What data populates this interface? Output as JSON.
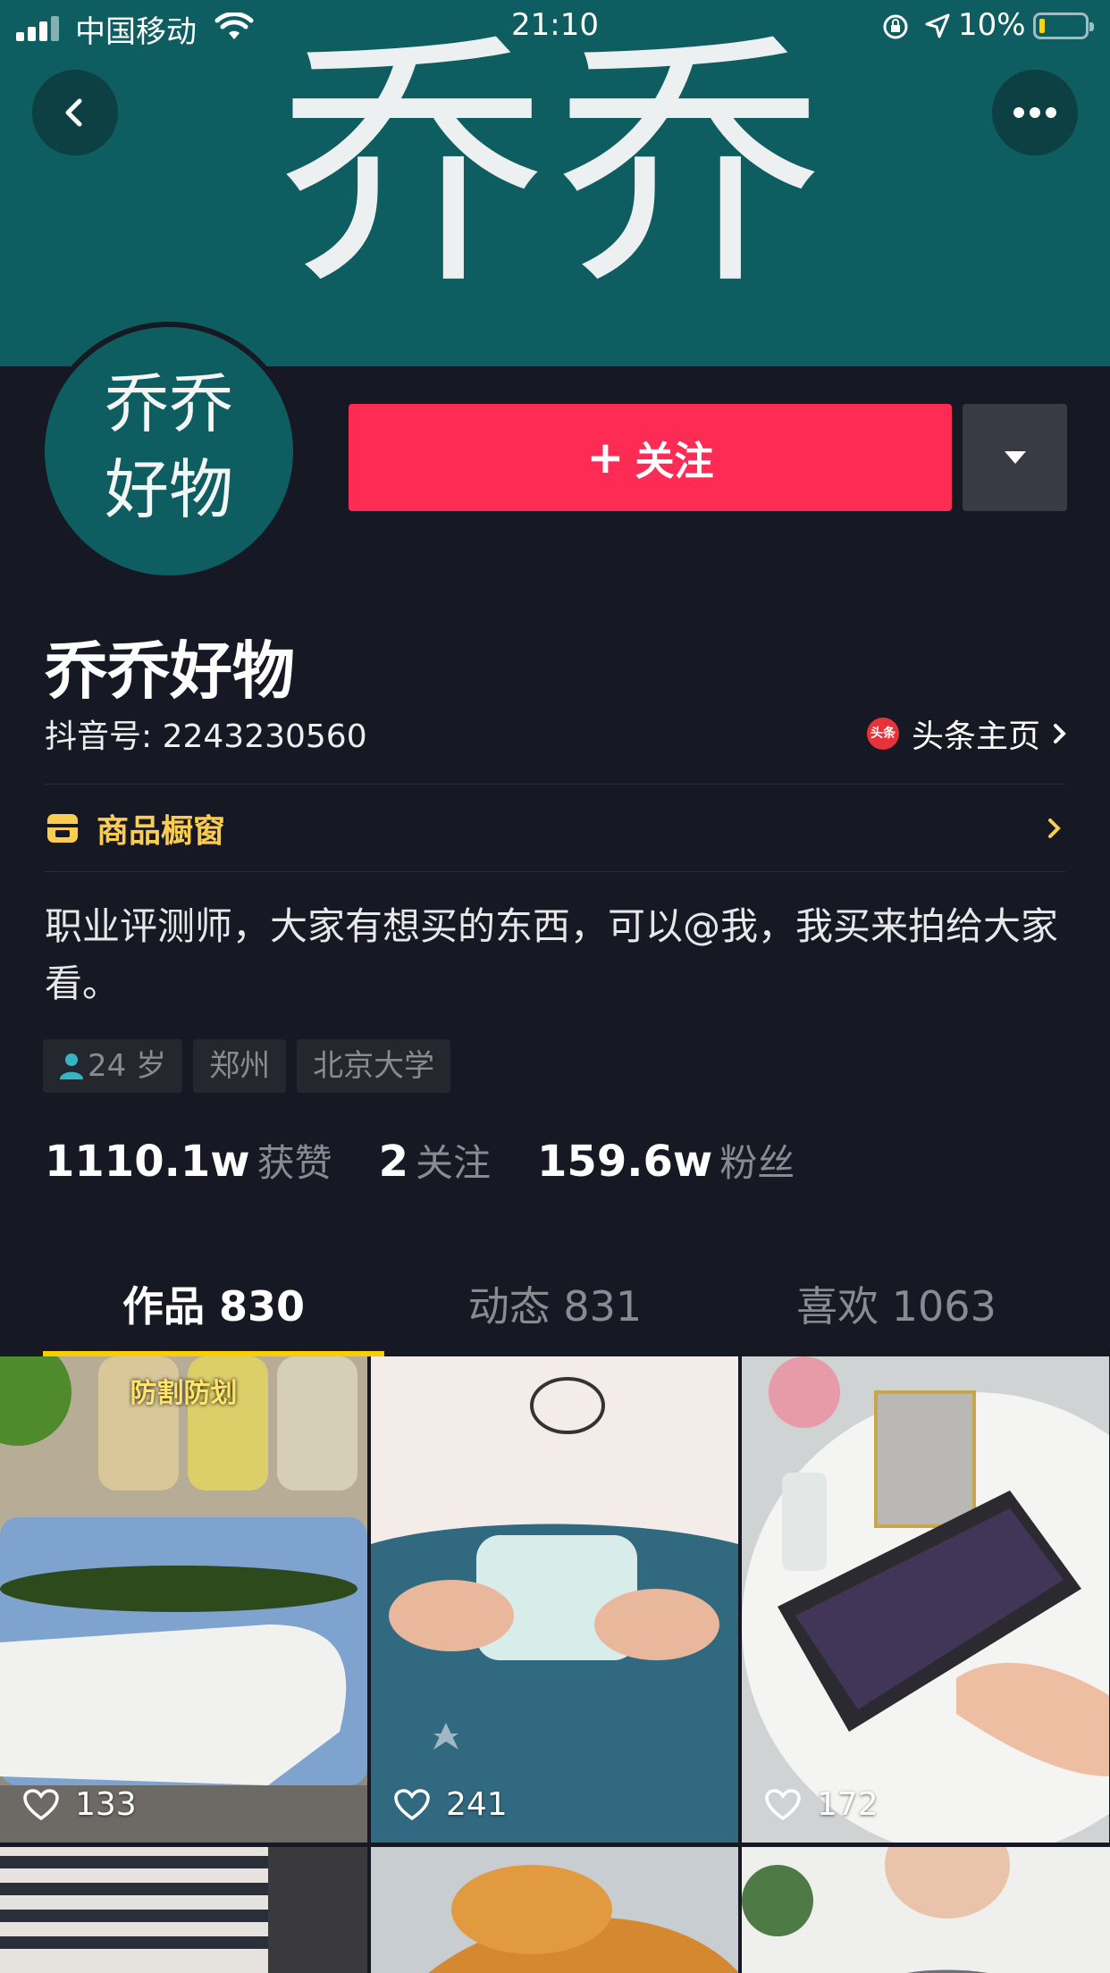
{
  "status_bar": {
    "carrier": "中国移动",
    "time": "21:10",
    "battery": "10%"
  },
  "banner": {
    "title": "乔乔"
  },
  "avatar": {
    "line1": "乔乔",
    "line2": "好物"
  },
  "actions": {
    "follow_label": "关注",
    "follow_plus": "+"
  },
  "profile": {
    "name": "乔乔好物",
    "douyin_id": "抖音号: 2243230560",
    "toutiao_label": "头条主页",
    "toutiao_badge": "头条",
    "shop_label": "商品橱窗",
    "bio": "职业评测师，大家有想买的东西，可以@我，我买来拍给大家看。",
    "tags": [
      "24 岁",
      "郑州",
      "北京大学"
    ]
  },
  "stats": {
    "likes_num": "1110.1w",
    "likes_label": "获赞",
    "following_num": "2",
    "following_label": "关注",
    "fans_num": "159.6w",
    "fans_label": "粉丝"
  },
  "tabs": [
    {
      "label": "作品 830"
    },
    {
      "label": "动态 831"
    },
    {
      "label": "喜欢 1063"
    }
  ],
  "videos": [
    {
      "caption": "防割防划",
      "likes": "133"
    },
    {
      "caption": "",
      "likes": "241"
    },
    {
      "caption": "",
      "likes": "172"
    }
  ],
  "colors": {
    "background": "#161823",
    "banner": "#0e5d60",
    "follow_button": "#fe2c55",
    "tab_indicator": "#facd00",
    "shop_accent": "#facd52"
  },
  "icons": {
    "back": "chevron-left-icon",
    "more": "more-dots-icon",
    "dropdown": "triangle-down-icon",
    "shop": "store-icon",
    "like": "heart-outline-icon",
    "age": "person-icon"
  }
}
